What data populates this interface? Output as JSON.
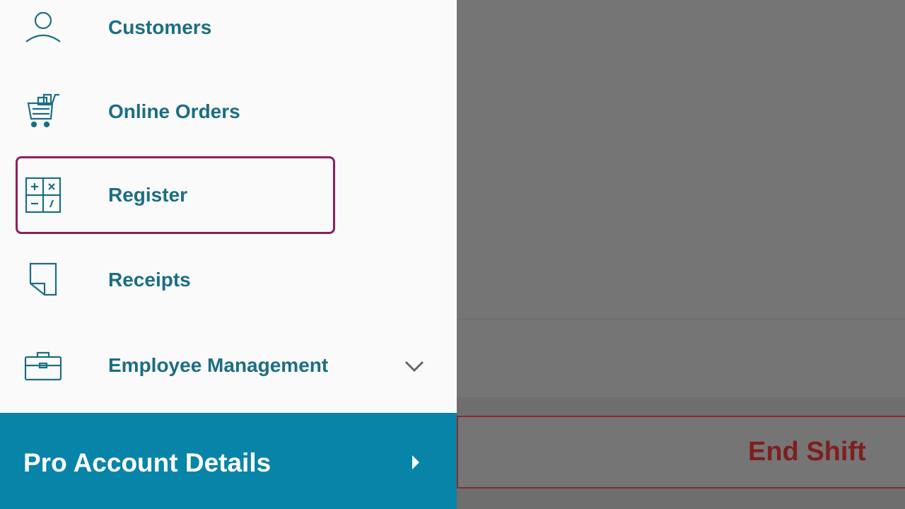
{
  "drawer": {
    "items": [
      {
        "label": "Customers",
        "icon": "person-icon",
        "selected": false
      },
      {
        "label": "Online Orders",
        "icon": "shopping-cart-icon",
        "selected": false
      },
      {
        "label": "Register",
        "icon": "calculator-icon",
        "selected": true
      },
      {
        "label": "Receipts",
        "icon": "receipt-icon",
        "selected": false
      },
      {
        "label": "Employee Management",
        "icon": "briefcase-icon",
        "selected": false,
        "expandable": true
      }
    ],
    "pro_account": {
      "label": "Pro Account Details",
      "icon": "arrow-right-icon"
    }
  },
  "background": {
    "end_shift_label": "End Shift"
  },
  "colors": {
    "accent": "#1b6e84",
    "selected_border": "#8e1f5e",
    "pro_bar": "#0784a8",
    "end_shift": "#7e1f1f",
    "scrim": "#757575"
  }
}
